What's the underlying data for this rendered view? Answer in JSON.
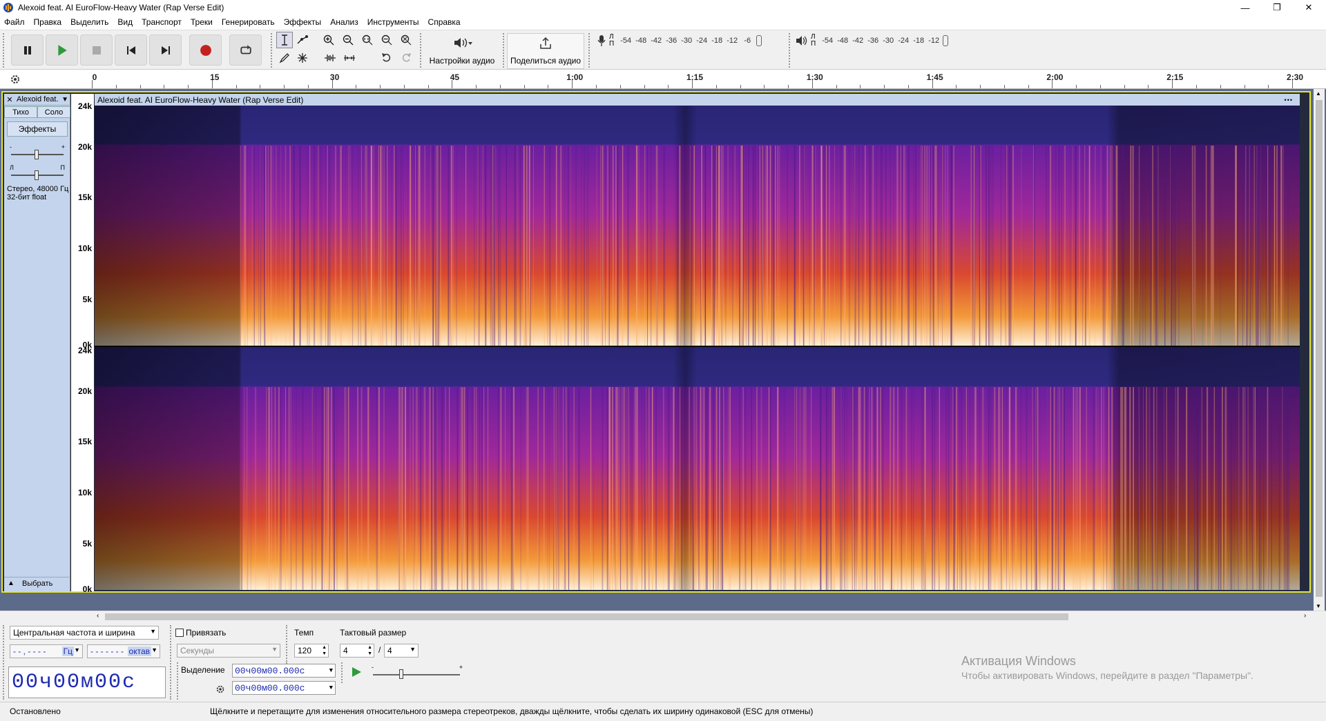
{
  "window": {
    "title": "Alexoid feat. AI EuroFlow-Heavy Water (Rap Verse Edit)",
    "minimize": "—",
    "maximize": "❐",
    "close": "✕"
  },
  "menu": [
    "Файл",
    "Правка",
    "Выделить",
    "Вид",
    "Транспорт",
    "Треки",
    "Генерировать",
    "Эффекты",
    "Анализ",
    "Инструменты",
    "Справка"
  ],
  "transport": {
    "pause_icon": "pause-icon",
    "play_icon": "play-icon",
    "stop_icon": "stop-icon",
    "skip_start_icon": "skip-start-icon",
    "skip_end_icon": "skip-end-icon",
    "record_icon": "record-icon",
    "loop_icon": "loop-icon"
  },
  "audio_setup": {
    "label": "Настройки аудио"
  },
  "share_audio": {
    "label": "Поделиться аудио"
  },
  "meters": {
    "record_scale": [
      "-54",
      "-48",
      "-42",
      "-36",
      "-30",
      "-24",
      "-18",
      "-12",
      "-6"
    ],
    "playback_scale": [
      "-54",
      "-48",
      "-42",
      "-36",
      "-30",
      "-24",
      "-18",
      "-12"
    ],
    "channel_left": "Л",
    "channel_right": "П"
  },
  "ruler": {
    "labels": [
      "0",
      "15",
      "30",
      "45",
      "1:00",
      "1:15",
      "1:30",
      "1:45",
      "2:00",
      "2:15",
      "2:30"
    ]
  },
  "track": {
    "name_short": "Alexoid feat.",
    "name_full": "Alexoid feat. AI EuroFlow-Heavy Water (Rap Verse Edit)",
    "mute": "Тихо",
    "solo": "Соло",
    "effects": "Эффекты",
    "gain_minus": "-",
    "gain_plus": "+",
    "pan_left": "Л",
    "pan_right": "П",
    "info_line1": "Стерео, 48000 Гц",
    "info_line2": "32-бит float",
    "select": "Выбрать",
    "menu_dots": "•••",
    "freq_labels": [
      "24k",
      "20k",
      "15k",
      "10k",
      "5k",
      "0k"
    ]
  },
  "bottom": {
    "spectral_mode": "Центральная частота и ширина",
    "freq_value": "- - , - - - -",
    "freq_unit": "Гц",
    "width_value": "- - - - - - -",
    "width_unit": "октав",
    "snap_label": "Привязать",
    "snap_unit": "Секунды",
    "tempo_label": "Темп",
    "tempo_value": "120",
    "timesig_label": "Тактовый размер",
    "timesig_num": "4",
    "timesig_sep": "/",
    "timesig_den": "4",
    "time_big": "00ч00м00с",
    "selection_label": "Выделение",
    "sel_start": "00ч00м00.000с",
    "sel_end": "00ч00м00.000с"
  },
  "status": {
    "state": "Остановлено",
    "hint": "Щёлкните и перетащите для изменения относительного размера стереотреков, дважды щёлкните, чтобы сделать их ширину одинаковой (ESC для отмены)"
  },
  "activation": {
    "line1": "Активация Windows",
    "line2": "Чтобы активировать Windows, перейдите в раздел \"Параметры\"."
  }
}
